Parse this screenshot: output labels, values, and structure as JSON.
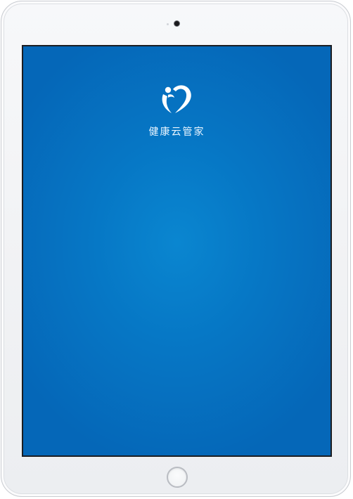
{
  "app": {
    "name": "健康云管家",
    "logo_icon": "heart-person-icon"
  },
  "colors": {
    "screen_bg": "#0677c5",
    "screen_bg_center": "#0a86d0",
    "text": "#eaf5ff",
    "device_frame": "#f2f3f5"
  }
}
